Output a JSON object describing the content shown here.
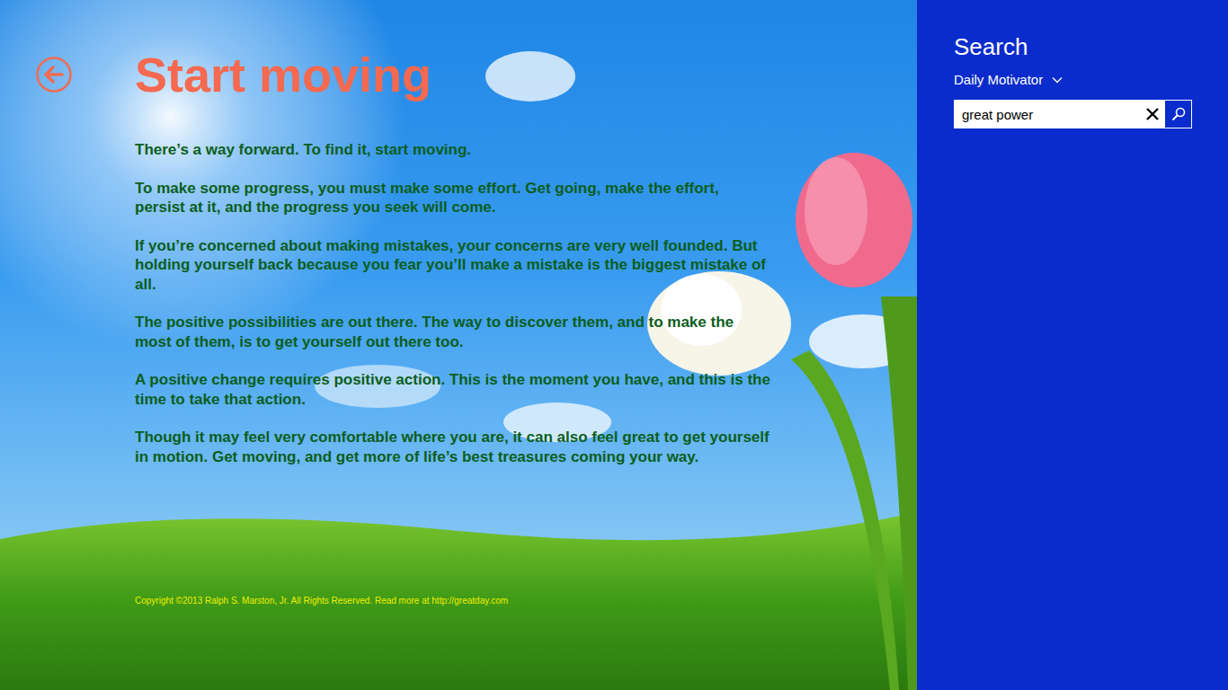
{
  "article": {
    "title": "Start moving",
    "paragraphs": [
      "There’s a way forward. To find it, start moving.",
      "To make some progress, you must make some effort. Get going, make the effort, persist at it, and the progress you seek will come.",
      "If you’re concerned about making mistakes, your concerns are very well founded. But holding yourself back because you fear you’ll make a mistake is the biggest mistake of all.",
      "The positive possibilities are out there. The way to discover them, and to make the most of them, is to get yourself out there too.",
      "A positive change requires positive action. This is the moment you have, and this is the time to take that action.",
      "Though it may feel very comfortable where you are, it can also feel great to get yourself in motion. Get moving, and get more of life’s best treasures coming your way."
    ],
    "copyright": "Copyright ©2013 Ralph S. Marston, Jr. All Rights Reserved. Read more at http://greatday.com"
  },
  "search_pane": {
    "title": "Search",
    "scope": "Daily Motivator",
    "query": "great power"
  }
}
